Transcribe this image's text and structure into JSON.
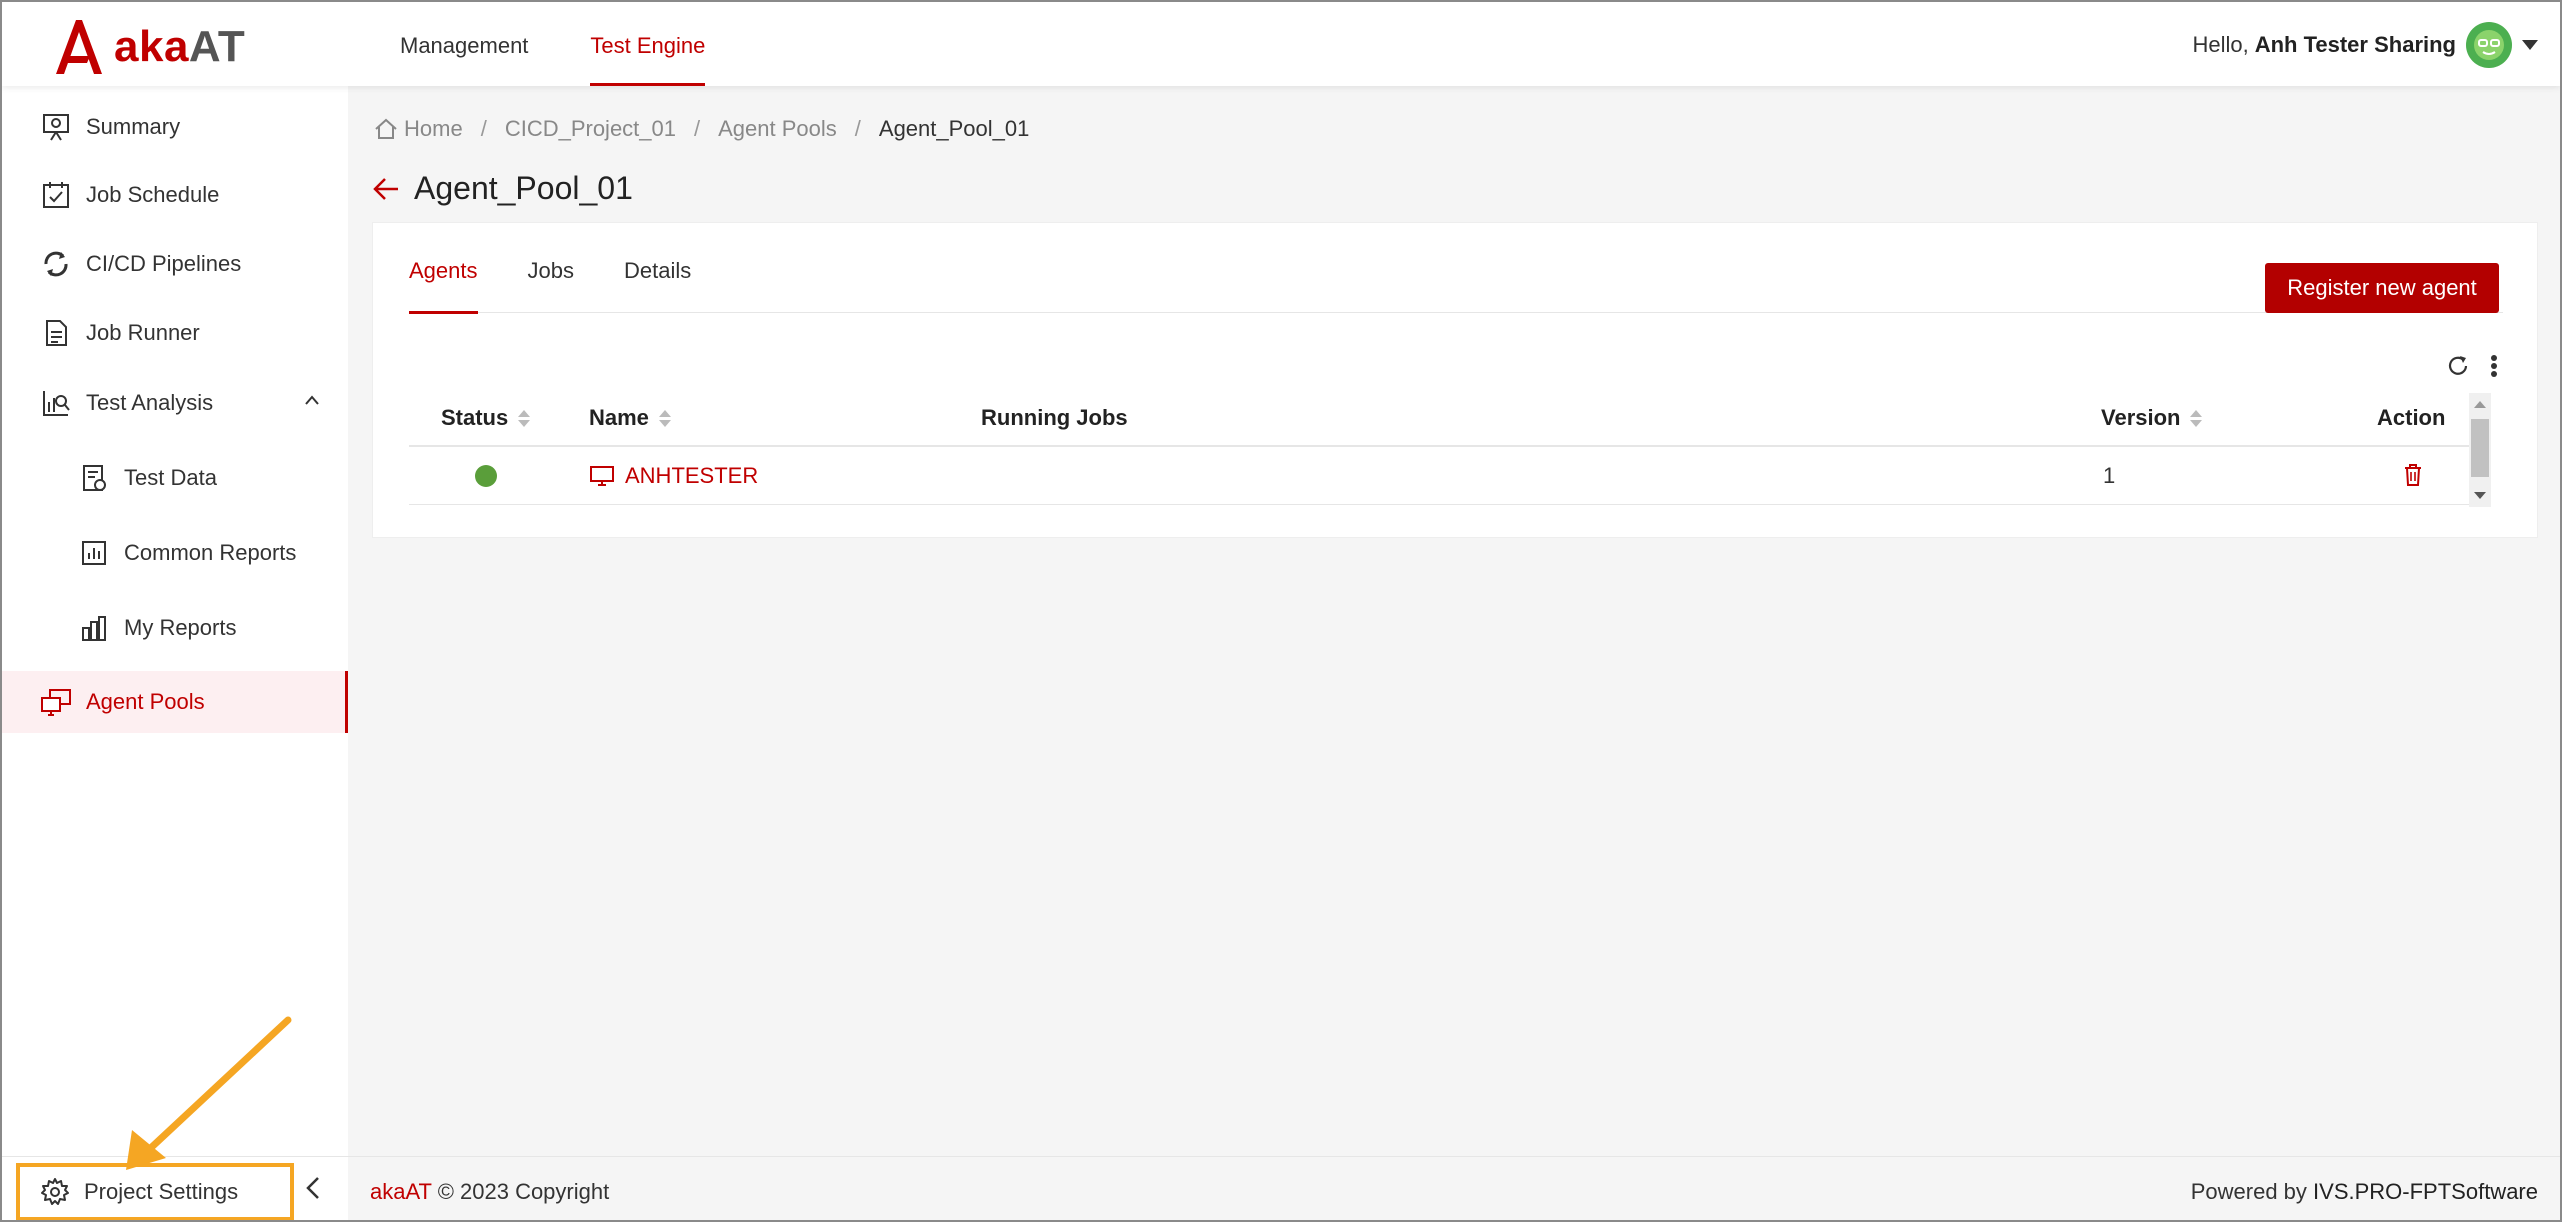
{
  "header": {
    "logo_text_aka": "aka",
    "logo_text_at": "AT",
    "nav": [
      {
        "label": "Management"
      },
      {
        "label": "Test Engine"
      }
    ],
    "greeting": "Hello,",
    "user_name": "Anh Tester Sharing"
  },
  "sidebar": {
    "items": [
      {
        "label": "Summary",
        "icon": "presentation-icon"
      },
      {
        "label": "Job Schedule",
        "icon": "calendar-check-icon"
      },
      {
        "label": "CI/CD Pipelines",
        "icon": "pipeline-icon"
      },
      {
        "label": "Job Runner",
        "icon": "document-icon"
      },
      {
        "label": "Test Analysis",
        "icon": "analysis-icon"
      },
      {
        "label": "Test Data",
        "icon": "test-data-icon"
      },
      {
        "label": "Common Reports",
        "icon": "report-icon"
      },
      {
        "label": "My Reports",
        "icon": "bar-chart-icon"
      },
      {
        "label": "Agent Pools",
        "icon": "agent-pools-icon"
      }
    ],
    "project_settings": "Project Settings"
  },
  "breadcrumb": {
    "home": "Home",
    "project": "CICD_Project_01",
    "section": "Agent Pools",
    "current": "Agent_Pool_01"
  },
  "page": {
    "title": "Agent_Pool_01"
  },
  "tabs": [
    {
      "label": "Agents"
    },
    {
      "label": "Jobs"
    },
    {
      "label": "Details"
    }
  ],
  "register_button": "Register new agent",
  "table": {
    "columns": [
      "Status",
      "Name",
      "Running Jobs",
      "Version",
      "Action"
    ],
    "rows": [
      {
        "status": "online",
        "name": "ANHTESTER",
        "running_jobs": "",
        "version": "1"
      }
    ]
  },
  "footer": {
    "brand": "akaAT",
    "copyright": "© 2023 Copyright",
    "powered_by": "Powered by",
    "company": "IVS.PRO-FPTSoftware"
  },
  "colors": {
    "accent": "#c00000",
    "button": "#b30000",
    "status_online": "#5a9e3a",
    "annotation": "#f5a623"
  }
}
